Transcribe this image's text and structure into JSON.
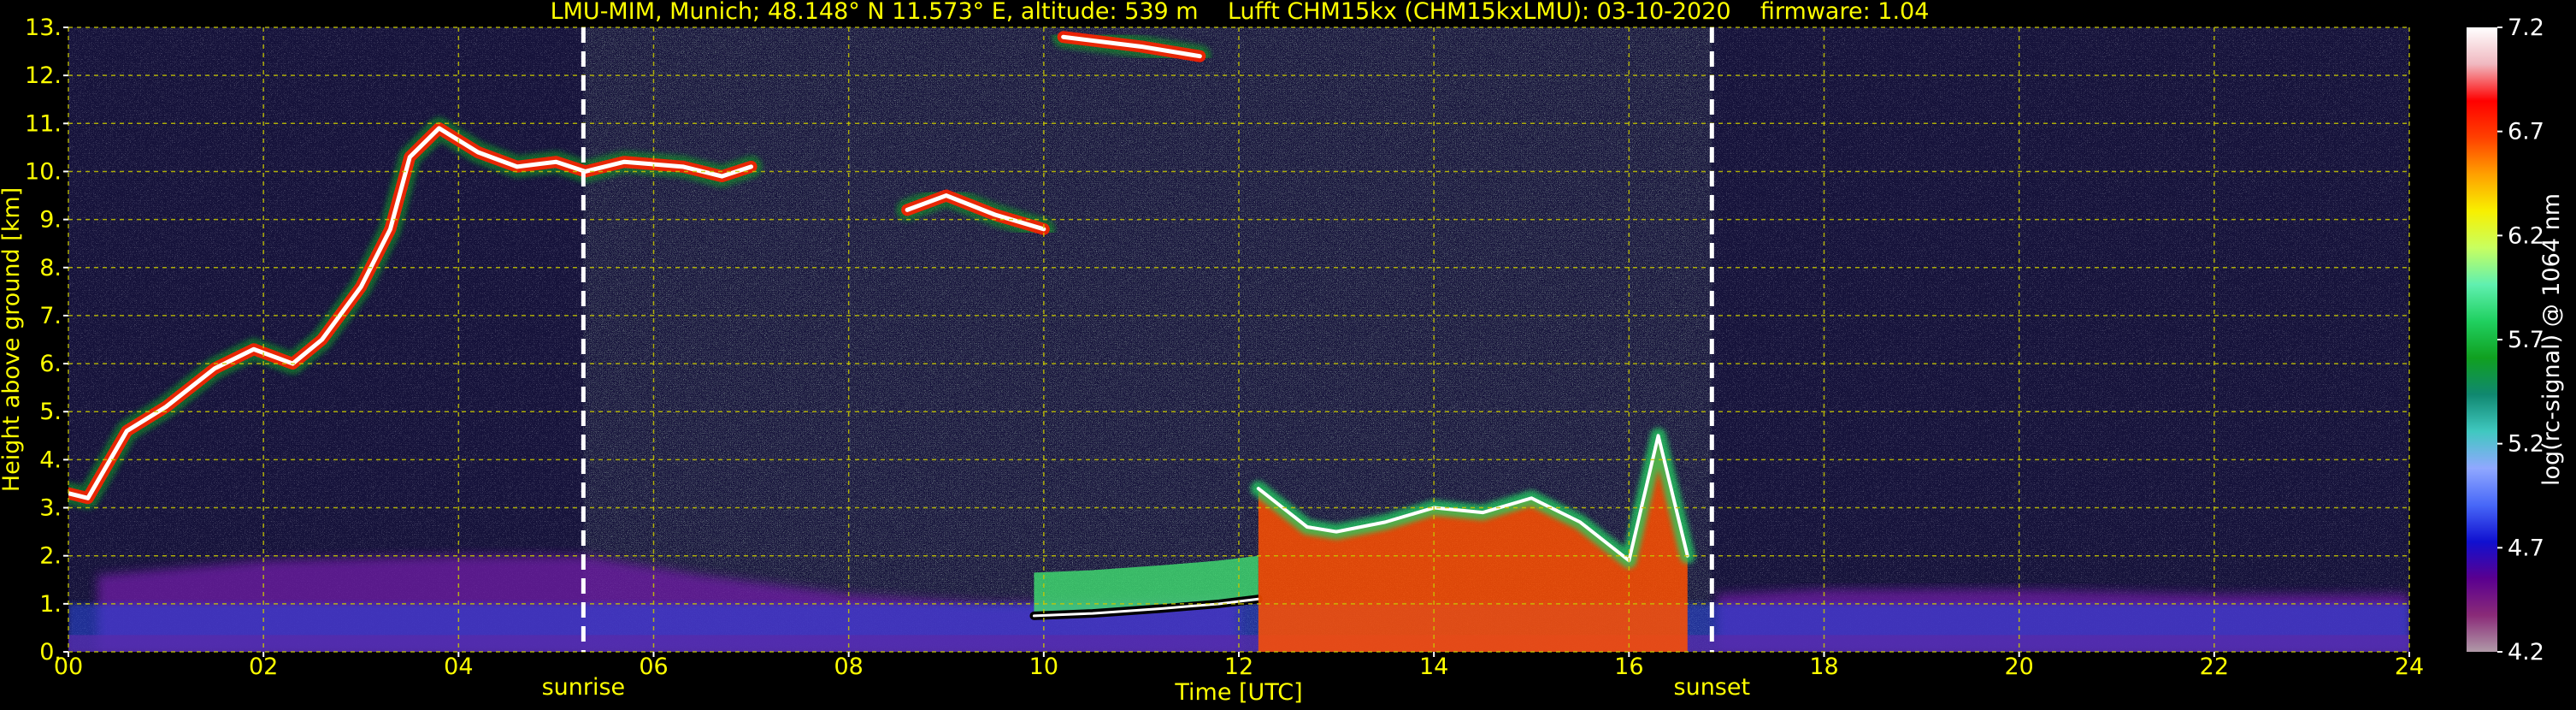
{
  "chart_data": {
    "type": "heatmap",
    "title": "LMU-MIM, Munich; 48.148° N 11.573° E, altitude: 539 m    Lufft CHM15kx (CHM15kxLMU): 03-10-2020    firmware: 1.04",
    "xlabel": "Time [UTC]",
    "ylabel": "Height above ground [km]",
    "xlim": [
      0,
      24
    ],
    "ylim": [
      0,
      13
    ],
    "x_ticks": [
      0,
      2,
      4,
      6,
      8,
      10,
      12,
      14,
      16,
      18,
      20,
      22,
      24
    ],
    "x_tick_labels": [
      "00",
      "02",
      "04",
      "06",
      "08",
      "10",
      "12",
      "14",
      "16",
      "18",
      "20",
      "22",
      "24"
    ],
    "y_ticks": [
      0,
      1,
      2,
      3,
      4,
      5,
      6,
      7,
      8,
      9,
      10,
      11,
      12,
      13
    ],
    "y_tick_labels": [
      "0.",
      "1.",
      "2.",
      "3.",
      "4.",
      "5.",
      "6.",
      "7.",
      "8.",
      "9.",
      "10.",
      "11.",
      "12.",
      "13."
    ],
    "grid": true,
    "annotations": [
      {
        "text": "sunrise",
        "x": 5.28
      },
      {
        "text": "sunset",
        "x": 16.85
      }
    ],
    "colorbar": {
      "label": "log(rc-signal) @ 1064 nm",
      "min": 4.2,
      "max": 7.2,
      "tick_values": [
        4.2,
        4.7,
        5.2,
        5.7,
        6.2,
        6.7,
        7.2
      ],
      "tick_labels": [
        "4.2",
        "4.7",
        "5.2",
        "5.7",
        "6.2",
        "6.7",
        "7.2"
      ],
      "colors": [
        "#b09aa8",
        "#8a2a78",
        "#5a0090",
        "#1010d0",
        "#4868f8",
        "#90a8ff",
        "#40c8c0",
        "#108870",
        "#10a020",
        "#20d060",
        "#60f0b0",
        "#c8ff60",
        "#f8f000",
        "#ffa000",
        "#ff4000",
        "#ff0000",
        "#f0b8c0",
        "#ffffff"
      ]
    },
    "background_color": "#15123a",
    "text_color": "#ffff00",
    "features": [
      {
        "type": "cirrus_layer",
        "points": [
          [
            0.0,
            3.3
          ],
          [
            0.2,
            3.2
          ],
          [
            0.4,
            3.9
          ],
          [
            0.6,
            4.6
          ],
          [
            1.0,
            5.1
          ],
          [
            1.5,
            5.9
          ],
          [
            1.9,
            6.3
          ],
          [
            2.3,
            6.0
          ],
          [
            2.6,
            6.5
          ],
          [
            3.0,
            7.6
          ],
          [
            3.3,
            8.8
          ],
          [
            3.5,
            10.3
          ],
          [
            3.8,
            10.9
          ],
          [
            4.2,
            10.4
          ],
          [
            4.6,
            10.1
          ],
          [
            5.0,
            10.2
          ],
          [
            5.3,
            10.0
          ],
          [
            5.7,
            10.2
          ],
          [
            6.3,
            10.1
          ],
          [
            6.7,
            9.9
          ],
          [
            7.0,
            10.1
          ]
        ]
      },
      {
        "type": "cirrus_layer",
        "points": [
          [
            8.6,
            9.2
          ],
          [
            9.0,
            9.5
          ],
          [
            9.5,
            9.1
          ],
          [
            10.0,
            8.8
          ]
        ]
      },
      {
        "type": "cirrus_layer",
        "points": [
          [
            10.2,
            12.8
          ],
          [
            11.0,
            12.6
          ],
          [
            11.6,
            12.4
          ]
        ]
      },
      {
        "type": "boundary_layer_top",
        "points": [
          [
            9.9,
            0.75
          ],
          [
            10.5,
            0.8
          ],
          [
            11.2,
            0.9
          ],
          [
            11.8,
            1.0
          ],
          [
            12.2,
            1.1
          ]
        ]
      },
      {
        "type": "low_cloud",
        "points": [
          [
            12.2,
            3.4
          ],
          [
            12.7,
            2.6
          ],
          [
            13.0,
            2.5
          ],
          [
            13.5,
            2.7
          ],
          [
            14.0,
            3.0
          ],
          [
            14.5,
            2.9
          ],
          [
            15.0,
            3.2
          ],
          [
            15.5,
            2.7
          ],
          [
            16.0,
            1.9
          ],
          [
            16.3,
            4.5
          ],
          [
            16.6,
            2.0
          ]
        ]
      },
      {
        "type": "aerosol_layer",
        "points": [
          [
            0.3,
            1.6
          ],
          [
            2.0,
            1.9
          ],
          [
            4.0,
            2.0
          ],
          [
            5.3,
            2.0
          ],
          [
            6.5,
            1.6
          ],
          [
            8.0,
            1.2
          ],
          [
            9.5,
            1.0
          ],
          [
            12.0,
            1.1
          ]
        ]
      },
      {
        "type": "aerosol_layer",
        "points": [
          [
            16.9,
            1.2
          ],
          [
            18.0,
            1.3
          ],
          [
            20.0,
            1.3
          ],
          [
            22.0,
            1.2
          ],
          [
            24.0,
            1.2
          ]
        ]
      }
    ]
  }
}
